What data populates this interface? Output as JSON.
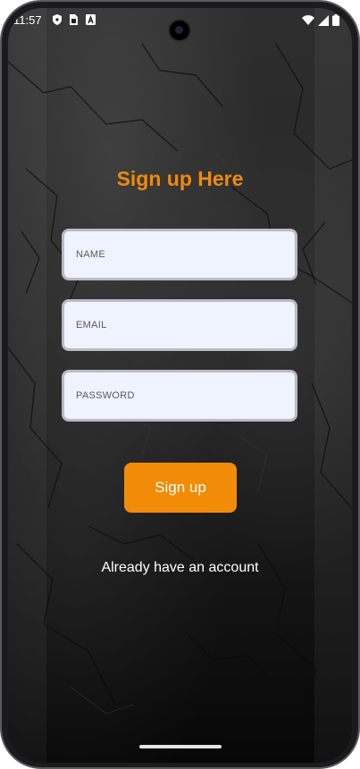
{
  "status_bar": {
    "time": "11:57",
    "left_icons": [
      "shield-icon",
      "sim-card-icon",
      "keyboard-a-icon"
    ],
    "right_icons": [
      "wifi-icon",
      "signal-icon",
      "battery-icon"
    ]
  },
  "form": {
    "title": "Sign up Here",
    "name_placeholder": "NAME",
    "email_placeholder": "EMAIL",
    "password_placeholder": "PASSWORD",
    "submit_label": "Sign up",
    "login_link": "Already have an account"
  },
  "colors": {
    "accent": "#f28c08",
    "title": "#f08a0b",
    "field_background": "#eff2ff",
    "field_border": "#b9bac4",
    "background_dark": "#1f1f1f"
  }
}
